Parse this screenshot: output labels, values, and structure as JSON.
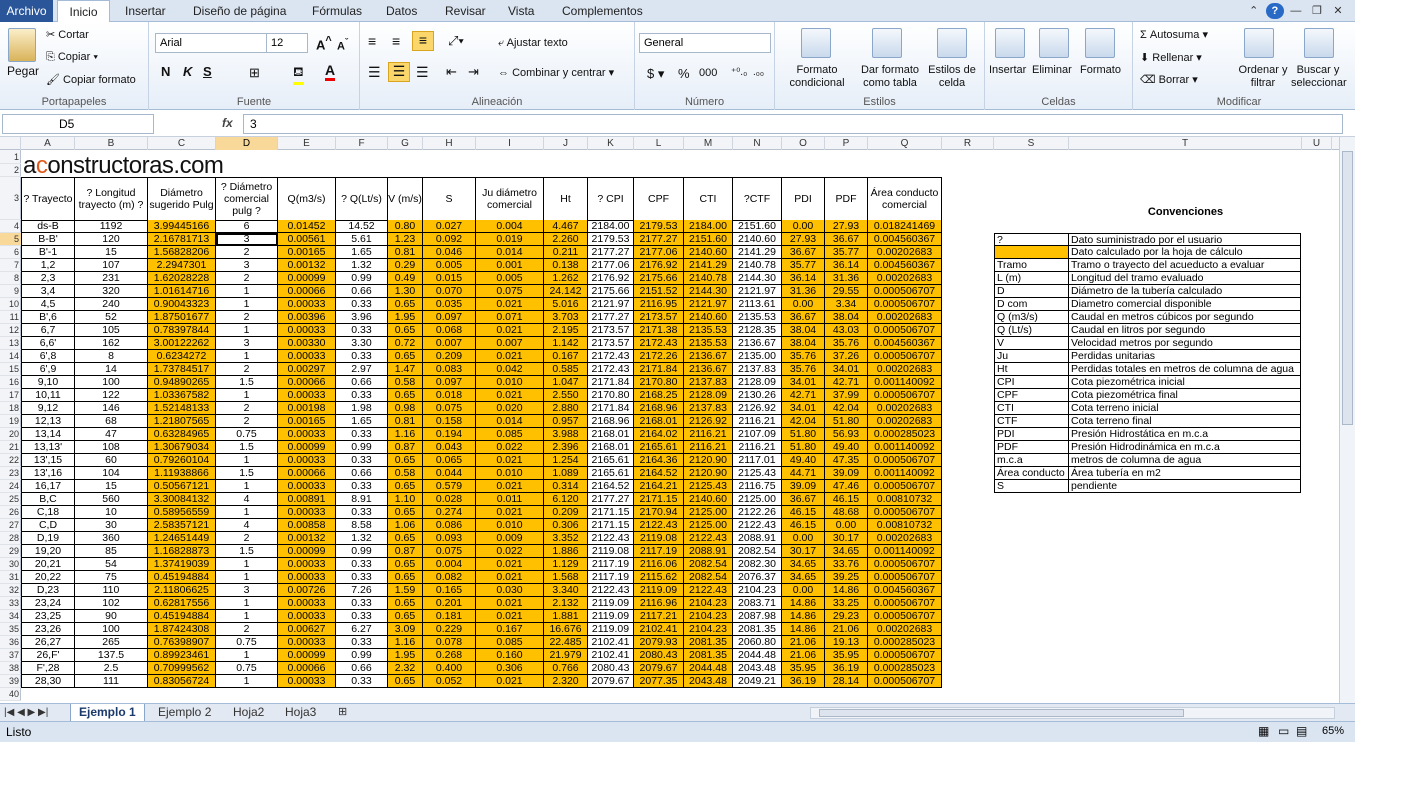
{
  "menu_tabs": [
    "Archivo",
    "Inicio",
    "Insertar",
    "Diseño de página",
    "Fórmulas",
    "Datos",
    "Revisar",
    "Vista",
    "Complementos"
  ],
  "ribbon": {
    "portapapeles": {
      "label": "Portapapeles",
      "paste": "Pegar",
      "cut": "Cortar",
      "copy": "Copiar",
      "format_painter": "Copiar formato"
    },
    "fuente": {
      "label": "Fuente",
      "font": "Arial",
      "size": "12"
    },
    "alineacion": {
      "label": "Alineación",
      "wrap": "Ajustar texto",
      "merge": "Combinar y centrar"
    },
    "numero": {
      "label": "Número",
      "format": "General",
      "currency": "$",
      "percent": "%",
      "thousands": "000"
    },
    "estilos": {
      "label": "Estilos",
      "cond": "Formato condicional",
      "table": "Dar formato como tabla",
      "cell": "Estilos de celda"
    },
    "celdas": {
      "label": "Celdas",
      "insert": "Insertar",
      "delete": "Eliminar",
      "format": "Formato"
    },
    "modificar": {
      "label": "Modificar",
      "autosum": "Autosuma",
      "fill": "Rellenar",
      "clear": "Borrar",
      "sort": "Ordenar y filtrar",
      "find": "Buscar y seleccionar"
    }
  },
  "formula_bar": {
    "cell_ref": "D5",
    "fx": "fx",
    "value": "3"
  },
  "columns": [
    "A",
    "B",
    "C",
    "D",
    "E",
    "F",
    "G",
    "H",
    "I",
    "J",
    "K",
    "L",
    "M",
    "N",
    "O",
    "P",
    "Q",
    "R",
    "S",
    "T",
    "U"
  ],
  "brand": {
    "a": "a",
    "c": "c",
    "rest": "onstructoras.com"
  },
  "headers": [
    "? Trayecto",
    "? Longitud trayecto (m) ?",
    "Diámetro sugerido Pulg",
    "? Diámetro comercial pulg ?",
    "Q(m3/s)",
    "? Q(Lt/s)",
    "V (m/s)",
    "S",
    "Ju diámetro comercial",
    "Ht",
    "? CPI",
    "CPF",
    "CTI",
    "?CTF",
    "PDI",
    "PDF",
    "Área conducto comercial"
  ],
  "rows": [
    [
      "ds-B",
      "1192",
      "3.99445166",
      "6",
      "0.01452",
      "14.52",
      "0.80",
      "0.027",
      "0.004",
      "4.467",
      "2184.00",
      "2179.53",
      "2184.00",
      "2151.60",
      "0.00",
      "27.93",
      "0.018241469"
    ],
    [
      "B-B'",
      "120",
      "2.16781713",
      "3",
      "0.00561",
      "5.61",
      "1.23",
      "0.092",
      "0.019",
      "2.260",
      "2179.53",
      "2177.27",
      "2151.60",
      "2140.60",
      "27.93",
      "36.67",
      "0.004560367"
    ],
    [
      "B'-1",
      "15",
      "1.56828206",
      "2",
      "0.00165",
      "1.65",
      "0.81",
      "0.046",
      "0.014",
      "0.211",
      "2177.27",
      "2177.06",
      "2140.60",
      "2141.29",
      "36.67",
      "35.77",
      "0.00202683"
    ],
    [
      "1,2",
      "107",
      "2.2947301",
      "3",
      "0.00132",
      "1.32",
      "0.29",
      "0.005",
      "0.001",
      "0.138",
      "2177.06",
      "2176.92",
      "2141.29",
      "2140.78",
      "35.77",
      "36.14",
      "0.004560367"
    ],
    [
      "2,3",
      "231",
      "1.62028228",
      "2",
      "0.00099",
      "0.99",
      "0.49",
      "0.015",
      "0.005",
      "1.262",
      "2176.92",
      "2175.66",
      "2140.78",
      "2144.30",
      "36.14",
      "31.36",
      "0.00202683"
    ],
    [
      "3,4",
      "320",
      "1.01614716",
      "1",
      "0.00066",
      "0.66",
      "1.30",
      "0.070",
      "0.075",
      "24.142",
      "2175.66",
      "2151.52",
      "2144.30",
      "2121.97",
      "31.36",
      "29.55",
      "0.000506707"
    ],
    [
      "4,5",
      "240",
      "0.90043323",
      "1",
      "0.00033",
      "0.33",
      "0.65",
      "0.035",
      "0.021",
      "5.016",
      "2121.97",
      "2116.95",
      "2121.97",
      "2113.61",
      "0.00",
      "3.34",
      "0.000506707"
    ],
    [
      "B',6",
      "52",
      "1.87501677",
      "2",
      "0.00396",
      "3.96",
      "1.95",
      "0.097",
      "0.071",
      "3.703",
      "2177.27",
      "2173.57",
      "2140.60",
      "2135.53",
      "36.67",
      "38.04",
      "0.00202683"
    ],
    [
      "6,7",
      "105",
      "0.78397844",
      "1",
      "0.00033",
      "0.33",
      "0.65",
      "0.068",
      "0.021",
      "2.195",
      "2173.57",
      "2171.38",
      "2135.53",
      "2128.35",
      "38.04",
      "43.03",
      "0.000506707"
    ],
    [
      "6,6'",
      "162",
      "3.00122262",
      "3",
      "0.00330",
      "3.30",
      "0.72",
      "0.007",
      "0.007",
      "1.142",
      "2173.57",
      "2172.43",
      "2135.53",
      "2136.67",
      "38.04",
      "35.76",
      "0.004560367"
    ],
    [
      "6',8",
      "8",
      "0.6234272",
      "1",
      "0.00033",
      "0.33",
      "0.65",
      "0.209",
      "0.021",
      "0.167",
      "2172.43",
      "2172.26",
      "2136.67",
      "2135.00",
      "35.76",
      "37.26",
      "0.000506707"
    ],
    [
      "6',9",
      "14",
      "1.73784517",
      "2",
      "0.00297",
      "2.97",
      "1.47",
      "0.083",
      "0.042",
      "0.585",
      "2172.43",
      "2171.84",
      "2136.67",
      "2137.83",
      "35.76",
      "34.01",
      "0.00202683"
    ],
    [
      "9,10",
      "100",
      "0.94890265",
      "1.5",
      "0.00066",
      "0.66",
      "0.58",
      "0.097",
      "0.010",
      "1.047",
      "2171.84",
      "2170.80",
      "2137.83",
      "2128.09",
      "34.01",
      "42.71",
      "0.001140092"
    ],
    [
      "10,11",
      "122",
      "1.03367582",
      "1",
      "0.00033",
      "0.33",
      "0.65",
      "0.018",
      "0.021",
      "2.550",
      "2170.80",
      "2168.25",
      "2128.09",
      "2130.26",
      "42.71",
      "37.99",
      "0.000506707"
    ],
    [
      "9,12",
      "146",
      "1.52148133",
      "2",
      "0.00198",
      "1.98",
      "0.98",
      "0.075",
      "0.020",
      "2.880",
      "2171.84",
      "2168.96",
      "2137.83",
      "2126.92",
      "34.01",
      "42.04",
      "0.00202683"
    ],
    [
      "12,13",
      "68",
      "1.21807565",
      "2",
      "0.00165",
      "1.65",
      "0.81",
      "0.158",
      "0.014",
      "0.957",
      "2168.96",
      "2168.01",
      "2126.92",
      "2116.21",
      "42.04",
      "51.80",
      "0.00202683"
    ],
    [
      "13,14",
      "47",
      "0.63284965",
      "0.75",
      "0.00033",
      "0.33",
      "1.16",
      "0.194",
      "0.085",
      "3.988",
      "2168.01",
      "2164.02",
      "2116.21",
      "2107.09",
      "51.80",
      "56.93",
      "0.000285023"
    ],
    [
      "13,13'",
      "108",
      "1.30679034",
      "1.5",
      "0.00099",
      "0.99",
      "0.87",
      "0.043",
      "0.022",
      "2.396",
      "2168.01",
      "2165.61",
      "2116.21",
      "2116.21",
      "51.80",
      "49.40",
      "0.001140092"
    ],
    [
      "13',15",
      "60",
      "0.79260104",
      "1",
      "0.00033",
      "0.33",
      "0.65",
      "0.065",
      "0.021",
      "1.254",
      "2165.61",
      "2164.36",
      "2120.90",
      "2117.01",
      "49.40",
      "47.35",
      "0.000506707"
    ],
    [
      "13',16",
      "104",
      "1.11938866",
      "1.5",
      "0.00066",
      "0.66",
      "0.58",
      "0.044",
      "0.010",
      "1.089",
      "2165.61",
      "2164.52",
      "2120.90",
      "2125.43",
      "44.71",
      "39.09",
      "0.001140092"
    ],
    [
      "16,17",
      "15",
      "0.50567121",
      "1",
      "0.00033",
      "0.33",
      "0.65",
      "0.579",
      "0.021",
      "0.314",
      "2164.52",
      "2164.21",
      "2125.43",
      "2116.75",
      "39.09",
      "47.46",
      "0.000506707"
    ],
    [
      "B,C",
      "560",
      "3.30084132",
      "4",
      "0.00891",
      "8.91",
      "1.10",
      "0.028",
      "0.011",
      "6.120",
      "2177.27",
      "2171.15",
      "2140.60",
      "2125.00",
      "36.67",
      "46.15",
      "0.00810732"
    ],
    [
      "C,18",
      "10",
      "0.58956559",
      "1",
      "0.00033",
      "0.33",
      "0.65",
      "0.274",
      "0.021",
      "0.209",
      "2171.15",
      "2170.94",
      "2125.00",
      "2122.26",
      "46.15",
      "48.68",
      "0.000506707"
    ],
    [
      "C,D",
      "30",
      "2.58357121",
      "4",
      "0.00858",
      "8.58",
      "1.06",
      "0.086",
      "0.010",
      "0.306",
      "2171.15",
      "2122.43",
      "2125.00",
      "2122.43",
      "46.15",
      "0.00",
      "0.00810732"
    ],
    [
      "D,19",
      "360",
      "1.24651449",
      "2",
      "0.00132",
      "1.32",
      "0.65",
      "0.093",
      "0.009",
      "3.352",
      "2122.43",
      "2119.08",
      "2122.43",
      "2088.91",
      "0.00",
      "30.17",
      "0.00202683"
    ],
    [
      "19,20",
      "85",
      "1.16828873",
      "1.5",
      "0.00099",
      "0.99",
      "0.87",
      "0.075",
      "0.022",
      "1.886",
      "2119.08",
      "2117.19",
      "2088.91",
      "2082.54",
      "30.17",
      "34.65",
      "0.001140092"
    ],
    [
      "20,21",
      "54",
      "1.37419039",
      "1",
      "0.00033",
      "0.33",
      "0.65",
      "0.004",
      "0.021",
      "1.129",
      "2117.19",
      "2116.06",
      "2082.54",
      "2082.30",
      "34.65",
      "33.76",
      "0.000506707"
    ],
    [
      "20,22",
      "75",
      "0.45194884",
      "1",
      "0.00033",
      "0.33",
      "0.65",
      "0.082",
      "0.021",
      "1.568",
      "2117.19",
      "2115.62",
      "2082.54",
      "2076.37",
      "34.65",
      "39.25",
      "0.000506707"
    ],
    [
      "D,23",
      "110",
      "2.11806625",
      "3",
      "0.00726",
      "7.26",
      "1.59",
      "0.165",
      "0.030",
      "3.340",
      "2122.43",
      "2119.09",
      "2122.43",
      "2104.23",
      "0.00",
      "14.86",
      "0.004560367"
    ],
    [
      "23,24",
      "102",
      "0.62817556",
      "1",
      "0.00033",
      "0.33",
      "0.65",
      "0.201",
      "0.021",
      "2.132",
      "2119.09",
      "2116.96",
      "2104.23",
      "2083.71",
      "14.86",
      "33.25",
      "0.000506707"
    ],
    [
      "23,25",
      "90",
      "0.45194884",
      "1",
      "0.00033",
      "0.33",
      "0.65",
      "0.181",
      "0.021",
      "1.881",
      "2119.09",
      "2117.21",
      "2104.23",
      "2087.98",
      "14.86",
      "29.23",
      "0.000506707"
    ],
    [
      "23,26",
      "100",
      "1.87424308",
      "2",
      "0.00627",
      "6.27",
      "3.09",
      "0.229",
      "0.167",
      "16.676",
      "2119.09",
      "2102.41",
      "2104.23",
      "2081.35",
      "14.86",
      "21.06",
      "0.00202683"
    ],
    [
      "26,27",
      "265",
      "0.76398907",
      "0.75",
      "0.00033",
      "0.33",
      "1.16",
      "0.078",
      "0.085",
      "22.485",
      "2102.41",
      "2079.93",
      "2081.35",
      "2060.80",
      "21.06",
      "19.13",
      "0.000285023"
    ],
    [
      "26,F'",
      "137.5",
      "0.89923461",
      "1",
      "0.00099",
      "0.99",
      "1.95",
      "0.268",
      "0.160",
      "21.979",
      "2102.41",
      "2080.43",
      "2081.35",
      "2044.48",
      "21.06",
      "35.95",
      "0.000506707"
    ],
    [
      "F',28",
      "2.5",
      "0.70999562",
      "0.75",
      "0.00066",
      "0.66",
      "2.32",
      "0.400",
      "0.306",
      "0.766",
      "2080.43",
      "2079.67",
      "2044.48",
      "2043.48",
      "35.95",
      "36.19",
      "0.000285023"
    ],
    [
      "28,30",
      "111",
      "0.83056724",
      "1",
      "0.00033",
      "0.33",
      "0.65",
      "0.052",
      "0.021",
      "2.320",
      "2079.67",
      "2077.35",
      "2043.48",
      "2049.21",
      "36.19",
      "28.14",
      "0.000506707"
    ]
  ],
  "conventions": {
    "title": "Convenciones",
    "items": [
      [
        "?",
        "Dato suministrado por el usuario"
      ],
      [
        "",
        "Dato calculado por la  hoja de cálculo"
      ],
      [
        "Tramo",
        "Tramo o trayecto del acueducto a evaluar"
      ],
      [
        "L (m)",
        "Longitud del tramo evaluado"
      ],
      [
        "D",
        "Diámetro de la tubería calculado"
      ],
      [
        "D com",
        "Diametro comercial disponible"
      ],
      [
        "Q (m3/s)",
        "Caudal en metros cúbicos por segundo"
      ],
      [
        "Q (Lt/s)",
        "Caudal en litros por segundo"
      ],
      [
        "V",
        "Velocidad metros por segundo"
      ],
      [
        "Ju",
        "Perdidas unitarias"
      ],
      [
        "Ht",
        "Perdidas totales en metros de columna de agua"
      ],
      [
        "CPI",
        "Cota piezométrica inicial"
      ],
      [
        "CPF",
        "Cota piezométrica final"
      ],
      [
        "CTI",
        "Cota terreno inicial"
      ],
      [
        "CTF",
        "Cota terreno final"
      ],
      [
        "PDI",
        "Presión Hidrostática  en m.c.a"
      ],
      [
        "PDF",
        "Presión Hidrodinámica  en m.c.a"
      ],
      [
        "m.c.a",
        "metros de columna de agua"
      ],
      [
        "Área conducto",
        "Área tubería en m2"
      ],
      [
        "S",
        "pendiente"
      ]
    ]
  },
  "sheet_tabs": [
    "Ejemplo 1",
    "Ejemplo 2",
    "Hoja2",
    "Hoja3"
  ],
  "status": {
    "ready": "Listo",
    "zoom": "65%"
  },
  "colors": {
    "calc": "#ffc000",
    "ribbon": "#dbe5f1",
    "file_tab": "#2a5699"
  }
}
